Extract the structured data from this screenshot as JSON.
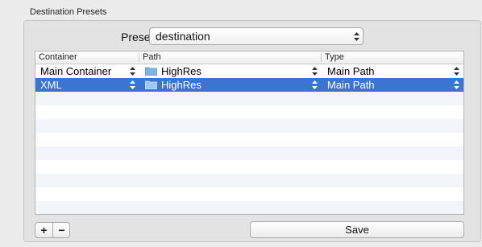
{
  "group": {
    "title": "Destination Presets"
  },
  "preset": {
    "label": "Preset:",
    "value": "destination"
  },
  "table": {
    "columns": [
      "Container",
      "Path",
      "Type"
    ],
    "rows": [
      {
        "container": "Main Container",
        "path": "HighRes",
        "type": "Main Path",
        "selected": false
      },
      {
        "container": "XML",
        "path": "HighRes",
        "type": "Main Path",
        "selected": true
      }
    ]
  },
  "buttons": {
    "add": "+",
    "remove": "−",
    "save": "Save"
  },
  "colors": {
    "selection": "#3a76d1",
    "stripe": "#f2f6fb",
    "folder": "#7fb3e6"
  },
  "icons": [
    "updown-arrows-icon",
    "folder-icon"
  ]
}
